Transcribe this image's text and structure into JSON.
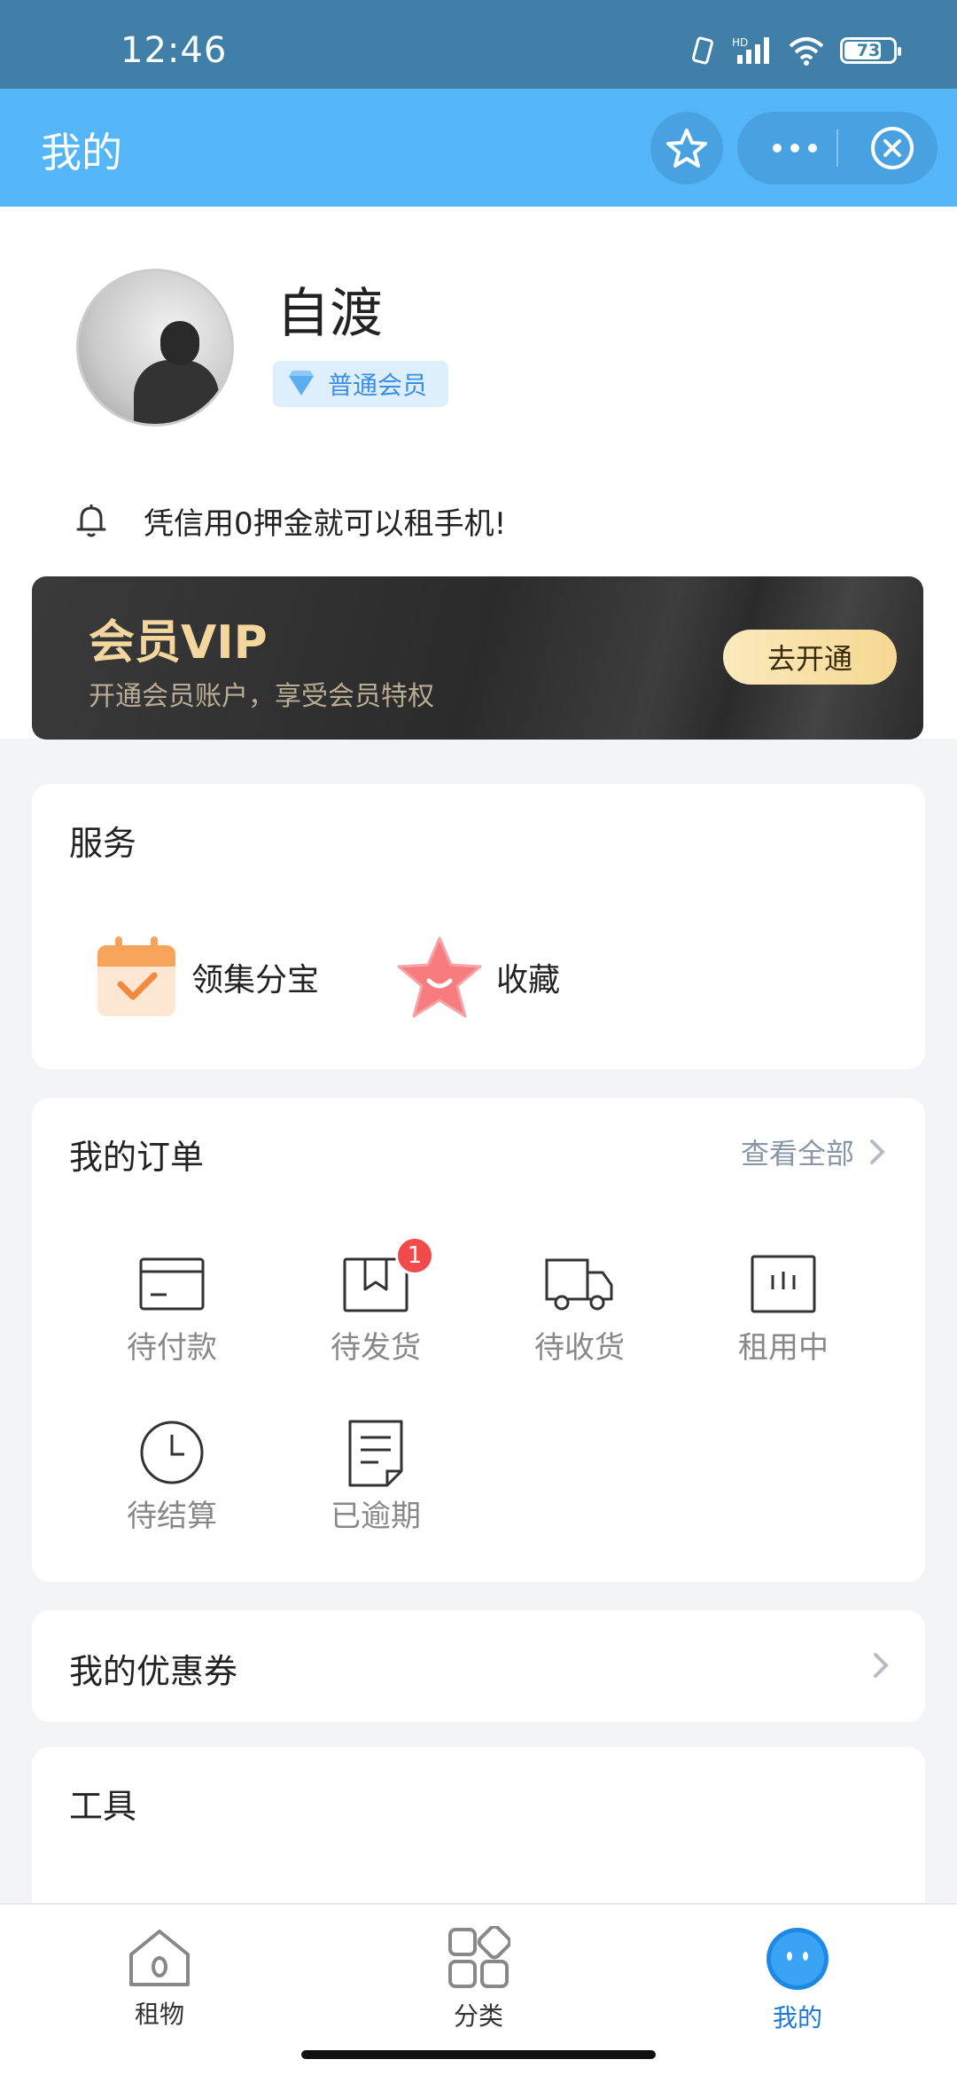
{
  "status_bar": {
    "time": "12:46",
    "battery": "73"
  },
  "header": {
    "title": "我的"
  },
  "profile": {
    "username": "自渡",
    "member_level": "普通会员",
    "notice": "凭信用0押金就可以租手机!"
  },
  "vip": {
    "title": "会员VIP",
    "subtitle": "开通会员账户，享受会员特权",
    "button": "去开通"
  },
  "services": {
    "title": "服务",
    "items": [
      {
        "label": "领集分宝",
        "icon": "calendar-check-icon"
      },
      {
        "label": "收藏",
        "icon": "star-icon"
      }
    ]
  },
  "orders": {
    "title": "我的订单",
    "view_all": "查看全部",
    "items": [
      {
        "label": "待付款",
        "icon": "card-icon"
      },
      {
        "label": "待发货",
        "icon": "box-icon",
        "badge": "1"
      },
      {
        "label": "待收货",
        "icon": "truck-icon"
      },
      {
        "label": "租用中",
        "icon": "rental-icon"
      },
      {
        "label": "待结算",
        "icon": "clock-icon"
      },
      {
        "label": "已逾期",
        "icon": "document-icon"
      }
    ]
  },
  "coupons": {
    "title": "我的优惠券"
  },
  "tools": {
    "title": "工具"
  },
  "bottom_nav": {
    "items": [
      {
        "label": "租物",
        "icon": "home-icon"
      },
      {
        "label": "分类",
        "icon": "category-icon"
      },
      {
        "label": "我的",
        "icon": "profile-face-icon",
        "active": true
      }
    ]
  },
  "colors": {
    "header": "#55b6f7",
    "accent": "#1a7ad8",
    "badge": "#f04a4a",
    "vip_gold": "#f3d69e"
  }
}
